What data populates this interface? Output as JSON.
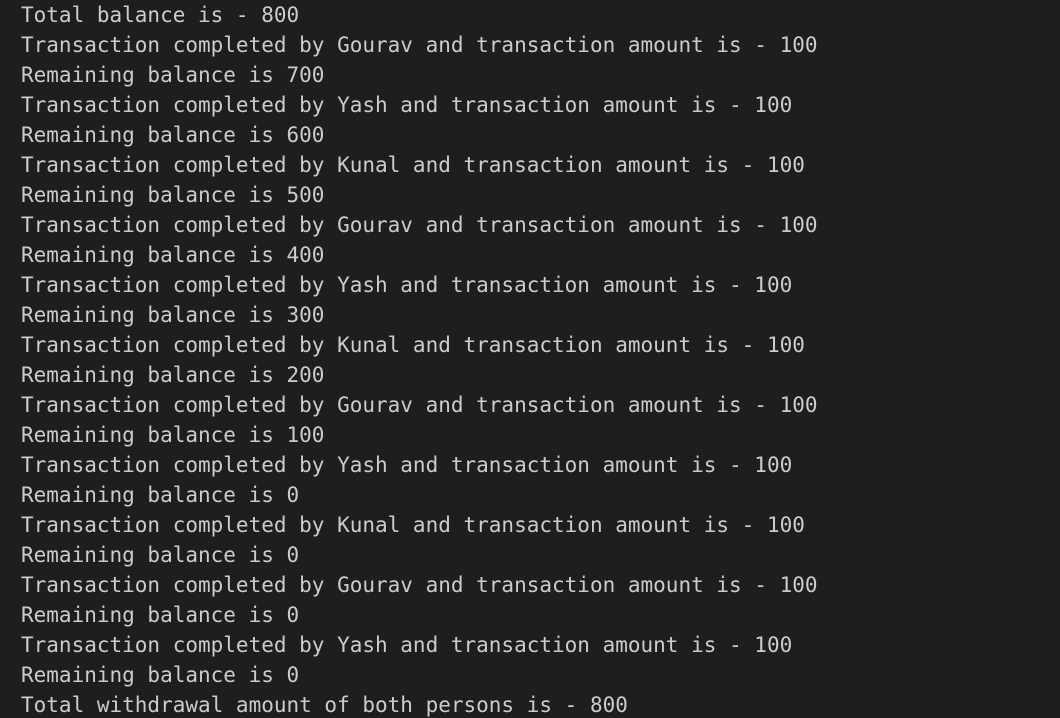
{
  "terminal": {
    "background": "#1e1e1e",
    "text_color": "#cccccc",
    "lines": [
      "Total balance is - 800",
      "Transaction completed by Gourav and transaction amount is - 100",
      "Remaining balance is 700",
      "Transaction completed by Yash and transaction amount is - 100",
      "Remaining balance is 600",
      "Transaction completed by Kunal and transaction amount is - 100",
      "Remaining balance is 500",
      "Transaction completed by Gourav and transaction amount is - 100",
      "Remaining balance is 400",
      "Transaction completed by Yash and transaction amount is - 100",
      "Remaining balance is 300",
      "Transaction completed by Kunal and transaction amount is - 100",
      "Remaining balance is 200",
      "Transaction completed by Gourav and transaction amount is - 100",
      "Remaining balance is 100",
      "Transaction completed by Yash and transaction amount is - 100",
      "Remaining balance is 0",
      "Transaction completed by Kunal and transaction amount is - 100",
      "Remaining balance is 0",
      "Transaction completed by Gourav and transaction amount is - 100",
      "Remaining balance is 0",
      "Transaction completed by Yash and transaction amount is - 100",
      "Remaining balance is 0",
      "Total withdrawal amount of both persons is - 800"
    ]
  }
}
